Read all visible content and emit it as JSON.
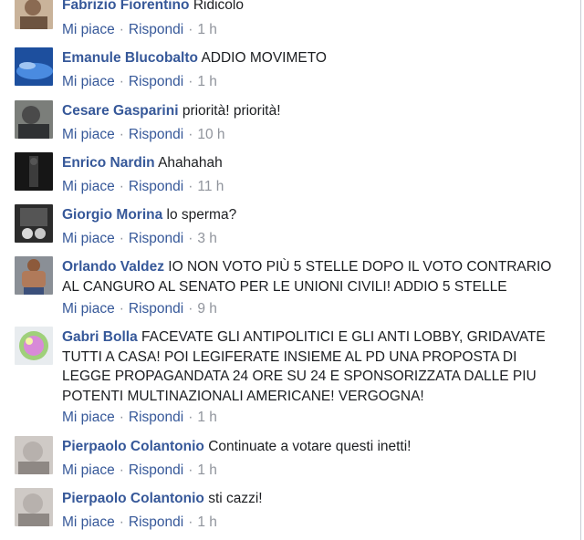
{
  "comments": [
    {
      "author": "Fabrizio Fiorentino",
      "text": "Ridicolo",
      "like": "Mi piace",
      "reply": "Rispondi",
      "time": "1 h",
      "avatar_color": "#8a6a52"
    },
    {
      "author": "Emanule Blucobalto",
      "text": "ADDIO MOVIMETO",
      "like": "Mi piace",
      "reply": "Rispondi",
      "time": "1 h",
      "avatar_color": "#2f64b8"
    },
    {
      "author": "Cesare Gasparini",
      "text": "priorità! priorità!",
      "like": "Mi piace",
      "reply": "Rispondi",
      "time": "10 h",
      "avatar_color": "#4a4a4a"
    },
    {
      "author": "Enrico Nardin",
      "text": "Ahahahah",
      "like": "Mi piace",
      "reply": "Rispondi",
      "time": "11 h",
      "avatar_color": "#1e1e1e"
    },
    {
      "author": "Giorgio Morina",
      "text": "lo sperma?",
      "like": "Mi piace",
      "reply": "Rispondi",
      "time": "3 h",
      "avatar_color": "#3a3a3a"
    },
    {
      "author": "Orlando Valdez",
      "text": "IO NON VOTO PIÙ 5 STELLE DOPO IL VOTO CONTRARIO AL CANGURO AL SENATO PER LE UNIONI CIVILI! ADDIO 5 STELLE",
      "like": "Mi piace",
      "reply": "Rispondi",
      "time": "9 h",
      "avatar_color": "#b07a5a"
    },
    {
      "author": "Gabri Bolla",
      "text": "FACEVATE GLI ANTIPOLITICI E GLI ANTI LOBBY, GRIDAVATE TUTTI A CASA! POI LEGIFERATE INSIEME AL PD UNA PROPOSTA DI LEGGE PROPAGANDATA 24 ORE SU 24 E SPONSORIZZATA DALLE PIU POTENTI MULTINAZIONALI AMERICANE! VERGOGNA!",
      "like": "Mi piace",
      "reply": "Rispondi",
      "time": "1 h",
      "avatar_color": "#6fa05a"
    },
    {
      "author": "Pierpaolo Colantonio",
      "text": "Continuate a votare questi inetti!",
      "like": "Mi piace",
      "reply": "Rispondi",
      "time": "1 h",
      "avatar_color": "#b7b1ad"
    },
    {
      "author": "Pierpaolo Colantonio",
      "text": "sti cazzi!",
      "like": "Mi piace",
      "reply": "Rispondi",
      "time": "1 h",
      "avatar_color": "#b7b1ad"
    }
  ]
}
